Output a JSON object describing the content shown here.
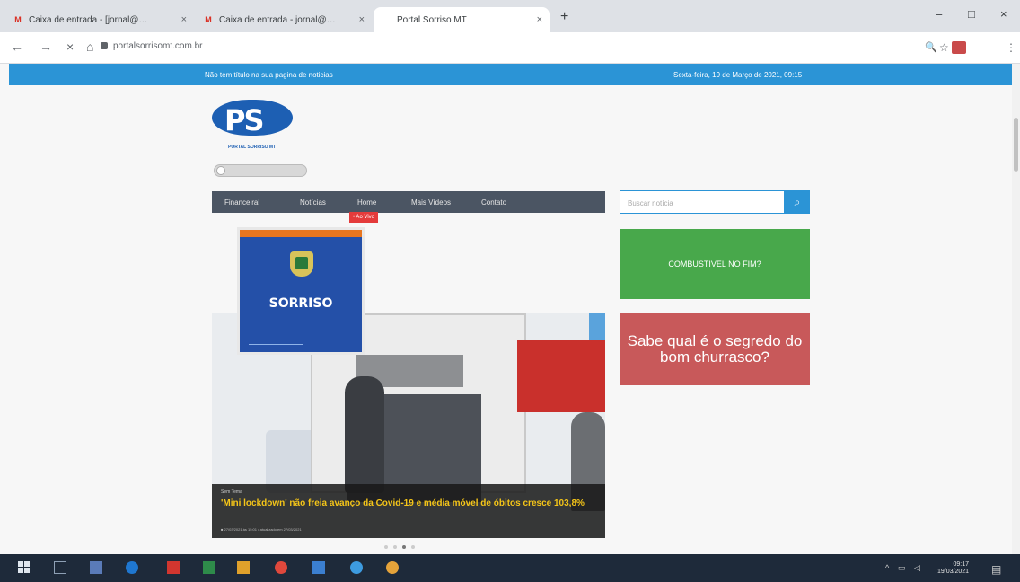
{
  "browser": {
    "tabs": [
      {
        "favicon": "M",
        "label": "Caixa de entrada - [jornal@…",
        "close": "×"
      },
      {
        "favicon": "M",
        "label": "Caixa de entrada - jornal@…",
        "close": "×"
      },
      {
        "favicon": "",
        "label": "Portal Sorriso MT",
        "close": "×"
      }
    ],
    "new_tab": "+",
    "window_controls": {
      "minimize": "–",
      "maximize": "□",
      "close": "×"
    },
    "nav": {
      "back": "←",
      "forward": "→",
      "stop": "×",
      "home": "⌂"
    },
    "address": "portalsorrisomt.com.br",
    "toolbar_icons": {
      "zoom": "🔍",
      "star": "☆",
      "menu": "⋮"
    }
  },
  "site": {
    "topbar_left": "Não tem título na sua pagina de noticias",
    "topbar_right": "Sexta-feira, 19 de Março de 2021, 09:15",
    "logo_text": "PS",
    "logo_sub": "PORTAL SORRISO MT",
    "menu": [
      "Financeiral",
      "Notícias",
      "Home",
      "Mais Vídeos",
      "Contato"
    ],
    "badge": "• Ao Vivo",
    "search_placeholder": "Buscar notícia",
    "search_button": "⌕",
    "ads": {
      "green": "COMBUSTÍVEL NO FIM?",
      "red": "Sabe qual é o segredo do bom churrasco?"
    },
    "promo": {
      "city": "SORRISO"
    },
    "feature": {
      "category": "Sem Tema",
      "headline": "'Mini lockdown' não freia avanço da Covid-19 e média móvel de óbitos cresce 103,8%",
      "meta": "■ 27/03/2021 às 15:01 • atualizado em 27/03/2021"
    }
  },
  "taskbar": {
    "time": "09:17",
    "date": "19/03/2021"
  }
}
